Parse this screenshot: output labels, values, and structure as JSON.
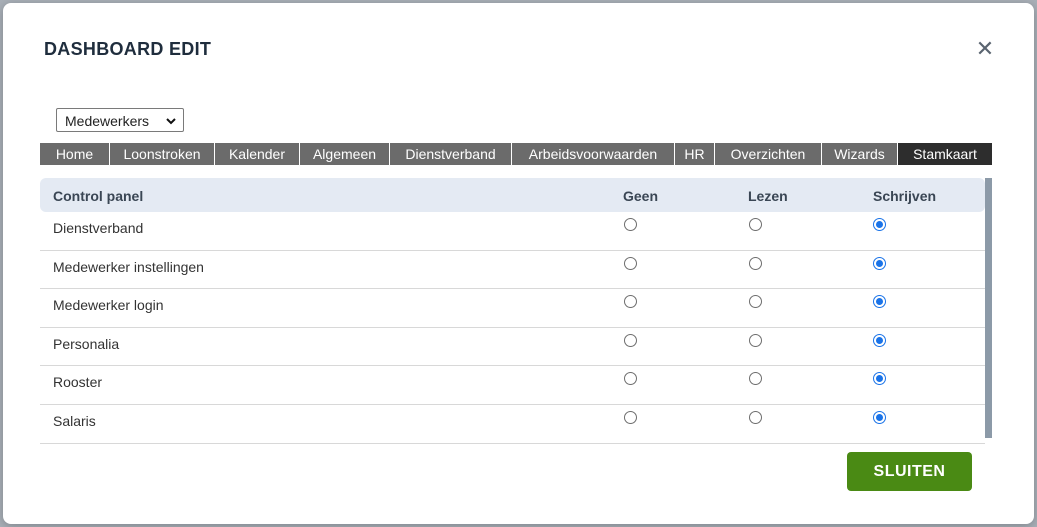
{
  "modal": {
    "title": "DASHBOARD EDIT",
    "close_icon": "close-icon",
    "close_glyph": "✕"
  },
  "select": {
    "value": "Medewerkers",
    "icon": "chevron-down-icon"
  },
  "tabs": [
    {
      "label": "Home",
      "active": false
    },
    {
      "label": "Loonstroken",
      "active": false
    },
    {
      "label": "Kalender",
      "active": false
    },
    {
      "label": "Algemeen",
      "active": false
    },
    {
      "label": "Dienstverband",
      "active": false
    },
    {
      "label": "Arbeidsvoorwaarden",
      "active": false
    },
    {
      "label": "HR",
      "active": false
    },
    {
      "label": "Overzichten",
      "active": false
    },
    {
      "label": "Wizards",
      "active": false
    },
    {
      "label": "Stamkaart",
      "active": true
    }
  ],
  "table": {
    "headers": {
      "name": "Control panel",
      "none": "Geen",
      "read": "Lezen",
      "write": "Schrijven"
    },
    "rows": [
      {
        "label": "Dienstverband",
        "selected": "write"
      },
      {
        "label": "Medewerker instellingen",
        "selected": "write"
      },
      {
        "label": "Medewerker login",
        "selected": "write"
      },
      {
        "label": "Personalia",
        "selected": "write"
      },
      {
        "label": "Rooster",
        "selected": "write"
      },
      {
        "label": "Salaris",
        "selected": "write"
      }
    ]
  },
  "footer": {
    "close_button": "SLUITEN"
  },
  "colors": {
    "tab_bar": "#6b6b6b",
    "tab_active": "#2d2d2d",
    "header_bg": "#e4eaf3",
    "radio_checked": "#1a73e8",
    "button_green": "#4a8a14"
  }
}
